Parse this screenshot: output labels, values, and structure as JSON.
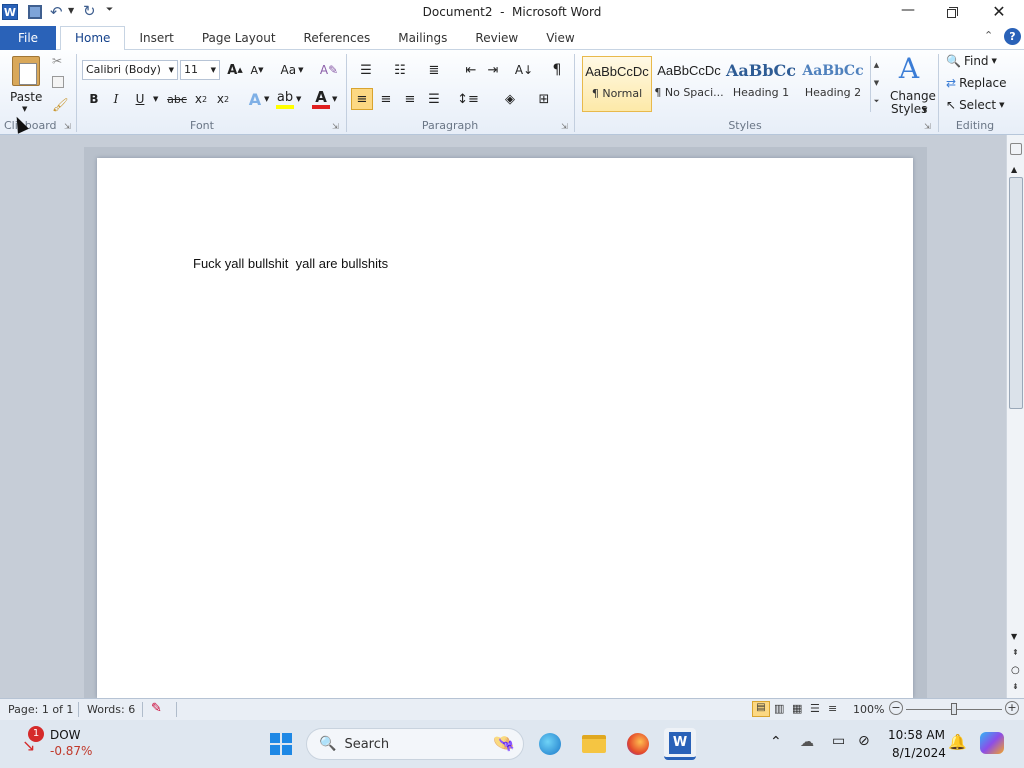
{
  "window": {
    "title": "Document2  -  Microsoft Word"
  },
  "tabs": {
    "file": "File",
    "items": [
      "Home",
      "Insert",
      "Page Layout",
      "References",
      "Mailings",
      "Review",
      "View"
    ]
  },
  "clipboard": {
    "paste": "Paste",
    "group": "Clipboard"
  },
  "font": {
    "name": "Calibri (Body)",
    "size": "11",
    "group": "Font",
    "bold": "B",
    "italic": "I",
    "underline": "U",
    "strike": "abc",
    "change_case": "Aa"
  },
  "paragraph": {
    "group": "Paragraph"
  },
  "styles": {
    "group": "Styles",
    "items": [
      {
        "preview": "AaBbCcDc",
        "label": "¶ Normal"
      },
      {
        "preview": "AaBbCcDc",
        "label": "¶ No Spaci..."
      },
      {
        "preview": "AaBbCc",
        "label": "Heading 1"
      },
      {
        "preview": "AaBbCc",
        "label": "Heading 2"
      }
    ],
    "change_styles": [
      "Change",
      "Styles"
    ]
  },
  "editing": {
    "group": "Editing",
    "find": "Find",
    "replace": "Replace",
    "select": "Select"
  },
  "document": {
    "text": "Fuck yall bullshit  yall are bullshits"
  },
  "status": {
    "page": "Page: 1 of 1",
    "words": "Words: 6",
    "zoom": "100%"
  },
  "taskbar": {
    "stock_name": "DOW",
    "stock_change": "-0.87%",
    "stock_badge": "1",
    "search": "Search",
    "time": "10:58 AM",
    "date": "8/1/2024"
  },
  "colors": {
    "accent": "#2a62b8",
    "ribbon_bg": "#e7eef8",
    "doc_bg": "#c6cdd7"
  }
}
